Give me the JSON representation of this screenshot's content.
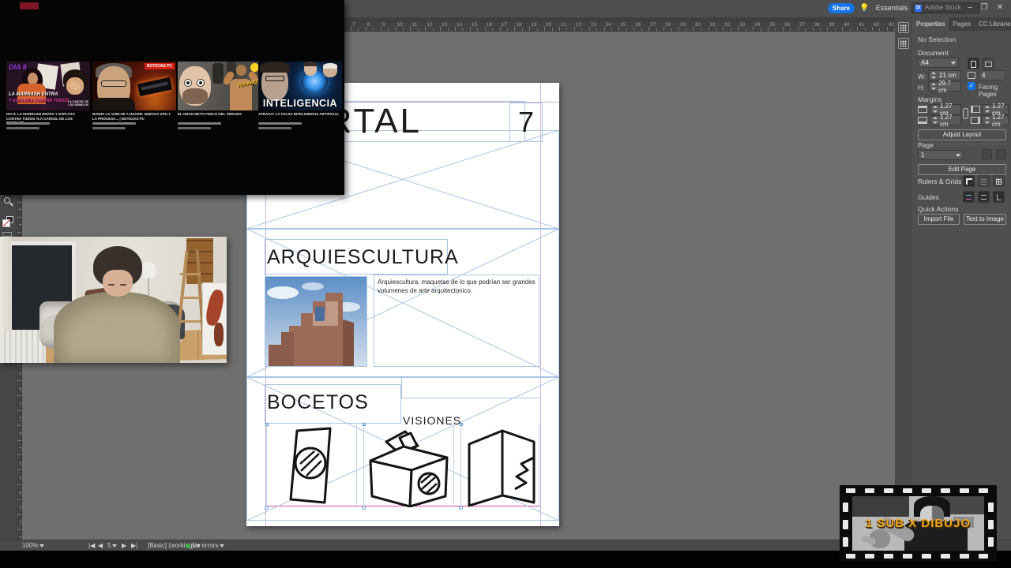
{
  "titlebar": {
    "share": "Share",
    "workspace": "Essentials",
    "search_placeholder": "Adobe Stock",
    "minimize": "–",
    "restore": "❐",
    "close": "✕"
  },
  "ruler": {
    "h_origin": 312,
    "h_step": 18.857,
    "h_min": -14,
    "h_max": 43,
    "v_origin": 105,
    "v_step": 18.857,
    "v_min": -3,
    "v_max": 30
  },
  "panel": {
    "tabs": [
      {
        "label": "Properties"
      },
      {
        "label": "Pages"
      },
      {
        "label": "CC Libraries"
      }
    ],
    "no_selection": "No Selection",
    "document": {
      "label": "Document",
      "preset": "A4",
      "w_label": "W:",
      "w": "21 cm",
      "h_label": "H:",
      "h": "29.7 cm",
      "pages": "4",
      "facing": "Facing Pages",
      "check": "✓"
    },
    "margins": {
      "label": "Margins",
      "top": "1.27 cm",
      "bottom": "1.27 cm",
      "left": "1.27 cm",
      "right": "1.27 cm",
      "adjust": "Adjust Layout"
    },
    "page": {
      "label": "Page",
      "current": "1",
      "edit": "Edit Page"
    },
    "rulers_grids": "Rulers & Grids",
    "guides": "Guides",
    "quick": {
      "label": "Quick Actions",
      "import": "Import File",
      "tti": "Text to Image"
    }
  },
  "doc": {
    "title": "PORTAL",
    "folio": "7",
    "h1": "ARQUIESCULTURA",
    "body": "Arquiescultura, maquetas de lo que podrían ser grandes volumenes de arte arquitectonico.",
    "h2": "BOCETOS",
    "sub": "VISIONES"
  },
  "status": {
    "zoom": "100%",
    "page": "5",
    "profile": "[Basic] (working)",
    "errors": "No errors"
  },
  "videos": [
    {
      "badge": "DIA 8",
      "line1": "LA MARRASH ENTRA",
      "line2": "Y EXPLOTA CONTRA TODOS",
      "logo": "LA CARCEL DE LOS GEMELOS",
      "caption": "DIA 8: LA MARRASH ENTRA Y EXPLOTA CONTRA TODOS #LA CARCEL DE LOS GEMELOS"
    },
    {
      "badge": "NOTICIAS PC",
      "caption": "NVIDIA LO VUELVE A HACER: NUEVAS GPU Y LA PROCESA... | NOTICIAS PC"
    },
    {
      "overlay": "VERANO",
      "caption": "EL GRAN RETO FISICO DEL VERANO"
    },
    {
      "word": "INTELIGENCIA",
      "caption": "ATRACO: LA FALSA INTELIGENCIA ARTIFICIAL"
    }
  ],
  "logo": {
    "text": "1 SUB X DIBUJO"
  },
  "colors": {
    "accent": "#1473e6",
    "frame_guide": "#a9c6e4",
    "margin_guide": "#c49ad2",
    "bottom_guide": "#d24fb4",
    "ok_green": "#37b24d",
    "logo_orange": "#f2a51f"
  }
}
